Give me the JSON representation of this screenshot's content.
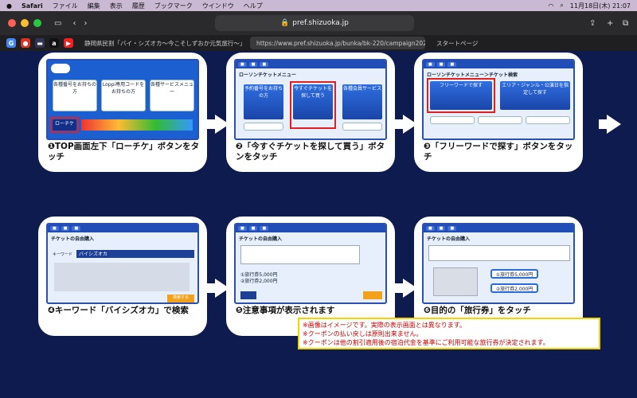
{
  "menubar": {
    "app": "Safari",
    "items": [
      "ファイル",
      "編集",
      "表示",
      "履歴",
      "ブックマーク",
      "ウインドウ",
      "ヘルプ"
    ],
    "datetime": "11月18日(木) 21:07"
  },
  "toolbar": {
    "url": "pref.shizuoka.jp"
  },
  "tabs": {
    "tab1": "静岡県民割「バイ・シズオカ〜今こそしずおか元気旅行〜」再開…",
    "tab2": "https://www.pref.shizuoka.jp/bunka/bk-220/campaign2020/…",
    "tab3": "スタートページ"
  },
  "steps": [
    {
      "caption": "❶TOP画面左下「ローチケ」ボタンをタッチ"
    },
    {
      "caption": "❷「今すぐチケットを探して買う」ボタンをタッチ"
    },
    {
      "caption": "❸「フリーワードで探す」ボタンをタッチ"
    },
    {
      "caption": "❹キーワード「バイシズオカ」で検索"
    },
    {
      "caption": "❺注意事項が表示されます"
    },
    {
      "caption": "❻目的の「旅行券」をタッチ"
    }
  ],
  "screens": {
    "s1": {
      "tile1": "各種番号をお持ちの方",
      "tile2": "Loppi専用コードをお持ちの方",
      "tile3": "各種サービスメニュー",
      "btn": "ローチケ"
    },
    "s2": {
      "title": "ローソンチケットメニュー",
      "tile1": "予約番号をお持ちの方",
      "tile2": "今すぐチケットを探して買う",
      "tile3": "各種会員サービス"
    },
    "s3": {
      "title": "ローソンチケットメニュー＞チケット検索",
      "tile1": "フリーワードで探す",
      "tile2": "エリア・ジャンル・公演日を指定して探す"
    },
    "s4": {
      "title": "チケットの自由購入",
      "keyword_label": "キーワード",
      "keyword": "バイシズオカ",
      "search": "検索する"
    },
    "s5": {
      "title": "チケットの自由購入",
      "item1": "①旅行券5,000円",
      "item2": "②旅行券2,000円"
    },
    "s6": {
      "title": "チケットの自由購入",
      "item1": "①旅行券5,000円",
      "item2": "②旅行券2,000円"
    }
  },
  "note": {
    "line1": "※画像はイメージです。実際の表示画面とは異なります。",
    "line2": "※クーポンの払い戻しは原則出来ません。",
    "line3": "※クーポンは他の割引適用後の宿泊代金を基準にご利用可能な旅行券が決定されます。"
  },
  "colors": {
    "bg": "#0e1b4f",
    "accent": "#214db6",
    "highlight": "#e02020"
  }
}
